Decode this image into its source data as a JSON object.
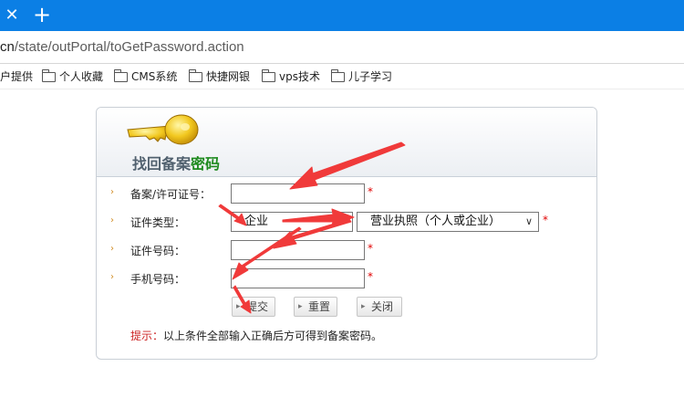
{
  "browser": {
    "url_prefix": "cn",
    "url_rest": "/state/outPortal/toGetPassword.action",
    "bookmarks": [
      {
        "label": "户提供"
      },
      {
        "label": "个人收藏"
      },
      {
        "label": "CMS系统"
      },
      {
        "label": "快捷网银"
      },
      {
        "label": "vps技术"
      },
      {
        "label": "儿子学习"
      }
    ]
  },
  "form": {
    "title_part1": "找回备案",
    "title_part2": "密码",
    "fields": [
      {
        "label": "备案/许可证号：",
        "value": "",
        "required": "*"
      },
      {
        "label": "证件类型：",
        "value": "企业",
        "select_value": "营业执照（个人或企业）",
        "required": "*"
      },
      {
        "label": "证件号码：",
        "value": "",
        "required": "*"
      },
      {
        "label": "手机号码：",
        "value": "",
        "required": "*"
      }
    ],
    "buttons": {
      "submit": "提交",
      "reset": "重置",
      "close": "关闭"
    },
    "hint_label": "提示：",
    "hint_text": "以上条件全部输入正确后方可得到备案密码。"
  },
  "colors": {
    "tabstrip": "#0b7fe5",
    "title_green": "#1e8a1e",
    "required_red": "#e00000",
    "annotation_arrow": "#f03a3a"
  },
  "icons": {
    "tab_close": "close-icon",
    "new_tab": "plus-icon",
    "bookmark": "folder-icon",
    "header": "key-icon",
    "dropdown": "chevron-down-icon"
  }
}
